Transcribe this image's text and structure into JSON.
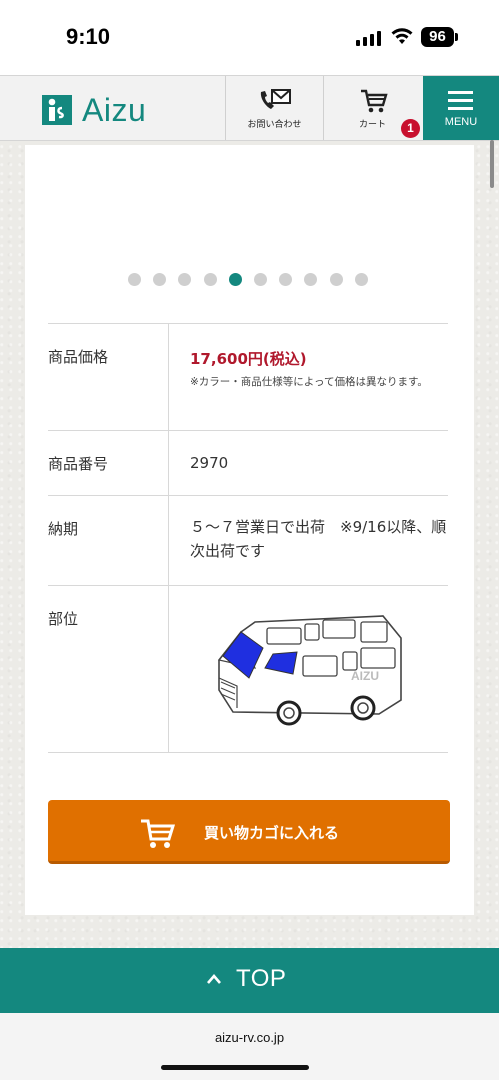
{
  "status": {
    "time": "9:10",
    "battery": "96"
  },
  "header": {
    "logo_text": "Aizu",
    "contact_label": "お問い合わせ",
    "cart_label": "カート",
    "cart_count": "1",
    "menu_label": "MENU"
  },
  "carousel": {
    "dot_count": 10,
    "active_index": 4
  },
  "product": {
    "price_label": "商品価格",
    "price": "17,600円(税込)",
    "price_note": "※カラー・商品仕様等によって価格は異なります。",
    "number_label": "商品番号",
    "number": "2970",
    "delivery_label": "納期",
    "delivery": "５～７営業日で出荷　※9/16以降、順次出荷です",
    "part_label": "部位",
    "van_text": "AIZU"
  },
  "cart_button": {
    "label": "買い物カゴに入れる"
  },
  "top_button": {
    "label": "TOP"
  },
  "browser": {
    "url": "aizu-rv.co.jp"
  },
  "colors": {
    "brand": "#14887f",
    "accent": "#e07000",
    "price": "#b0182c"
  }
}
